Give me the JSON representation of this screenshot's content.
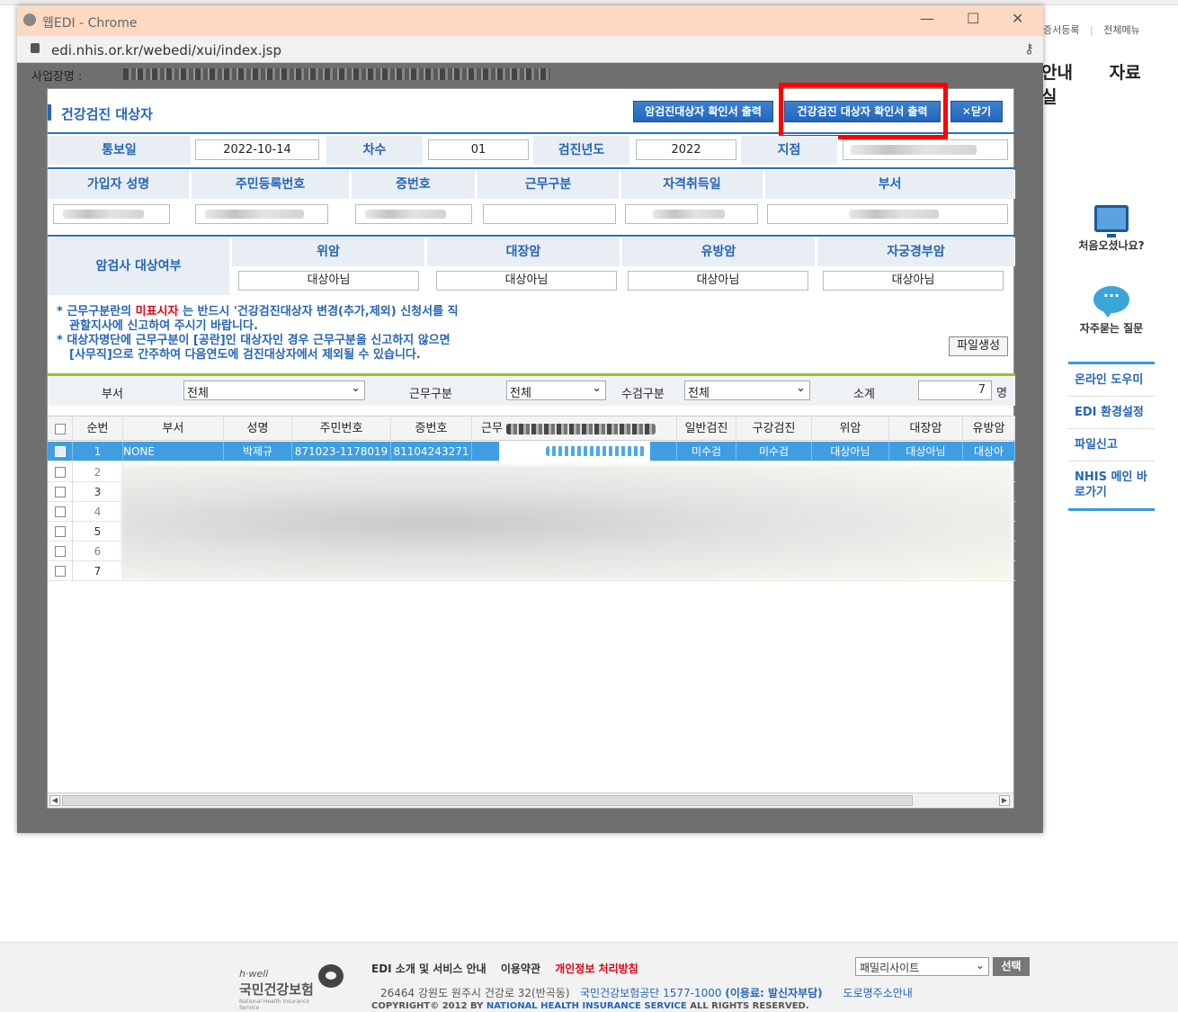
{
  "background": {
    "top_links": [
      "증서등록",
      "전체메뉴"
    ],
    "nav": [
      "안내",
      "자료실"
    ],
    "side_icons": [
      {
        "label": "처음오셨나요?",
        "icon": "monitor-icon"
      },
      {
        "label": "자주묻는 질문",
        "icon": "chat-bubble-icon",
        "glyph": "···"
      }
    ],
    "side_links": [
      "온라인 도우미",
      "EDI 환경설정",
      "파일신고",
      "NHIS 메인 바로가기"
    ]
  },
  "footer": {
    "logo_hwell": "h·well",
    "logo_org": "국민건강보험",
    "logo_en": "National Health Insurance Service",
    "links": [
      "EDI 소개 및 서비스 안내",
      "이용약관",
      "개인정보 처리방침"
    ],
    "addr_main": "26464 강원도 원주시 건강로 32(반곡동)",
    "addr_org": "국민건강보험공단 1577-1000",
    "addr_fee": "(이용료: 발신자부담)",
    "addr_road": "도로명주소안내",
    "copyright_prefix": "COPYRIGHT© 2012 BY",
    "copyright_org": "NATIONAL HEALTH INSURANCE SERVICE",
    "copyright_suffix": "ALL RIGHTS RESERVED.",
    "family_site": "패밀리사이트",
    "select_btn": "선택"
  },
  "chrome": {
    "title": "웹EDI - Chrome",
    "url": "edi.nhis.or.kr/webedi/xui/index.jsp",
    "biz_label": "사업장명 :",
    "controls": [
      "—",
      "☐",
      "✕"
    ]
  },
  "dialog": {
    "title": "건강검진 대상자",
    "btn_cancer_print": "암검진대상자 확인서 출력",
    "btn_health_print": "건강검진 대상자 확인서 출력",
    "btn_close": "✕닫기",
    "info": {
      "notice_date_label": "통보일",
      "notice_date": "2022-10-14",
      "round_label": "차수",
      "round": "01",
      "year_label": "검진년도",
      "year": "2022",
      "branch_label": "지점"
    },
    "member_headers": [
      "가입자 성명",
      "주민등록번호",
      "증번호",
      "근무구분",
      "자격취득일",
      "부서"
    ],
    "cancer_label": "암검사 대상여부",
    "cancer_types": [
      "위암",
      "대장암",
      "유방암",
      "자궁경부암"
    ],
    "cancer_values": [
      "대상아님",
      "대상아님",
      "대상아님",
      "대상아님"
    ],
    "notice_line1_a": "* 근무구분란의 ",
    "notice_line1_red": "미표시자",
    "notice_line1_b": " 는 반드시 '건강검진대상자 변경(추가,제외) 신청서를 직",
    "notice_line2": "관할지사에 신고하여 주시기 바랍니다.",
    "notice_line3": "* 대상자명단에 근무구분이 [공란]인 대상자인 경우 근무구분을 신고하지 않으면",
    "notice_line4": "[사무직]으로 간주하여 다음연도에 검진대상자에서 제외될 수 있습니다.",
    "file_btn": "파일생성",
    "filter": {
      "dept_label": "부서",
      "dept_value": "전체",
      "work_label": "근무구분",
      "work_value": "전체",
      "exam_label": "수검구분",
      "exam_value": "전체",
      "subtotal_label": "소계",
      "subtotal_value": "7",
      "unit": "명"
    },
    "grid_headers": [
      "순번",
      "부서",
      "성명",
      "주민번호",
      "증번호",
      "근무",
      "일반검진",
      "구강검진",
      "위암",
      "대장암",
      "유방암"
    ],
    "grid_rows": [
      {
        "no": "1",
        "dept": "NONE",
        "name": "박제규",
        "rrn": "871023-1178019",
        "card": "81104243271",
        "general": "미수검",
        "oral": "미수검",
        "stomach": "대상아님",
        "colon": "대상아님",
        "breast": "대상아"
      },
      {
        "no": "2"
      },
      {
        "no": "3"
      },
      {
        "no": "4"
      },
      {
        "no": "5"
      },
      {
        "no": "6"
      },
      {
        "no": "7"
      }
    ]
  }
}
